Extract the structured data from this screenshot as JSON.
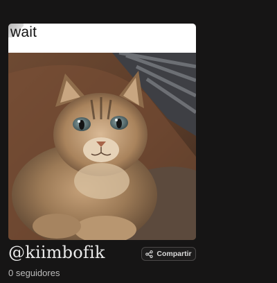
{
  "card": {
    "caption": "wait"
  },
  "profile": {
    "username": "@kiimbofik",
    "followers": "0 seguidores"
  },
  "actions": {
    "share_label": "Compartir",
    "share_icon": "share-icon"
  },
  "colors": {
    "background": "#161515",
    "caption_band": "#ffffff",
    "button_border": "#4a4848"
  }
}
